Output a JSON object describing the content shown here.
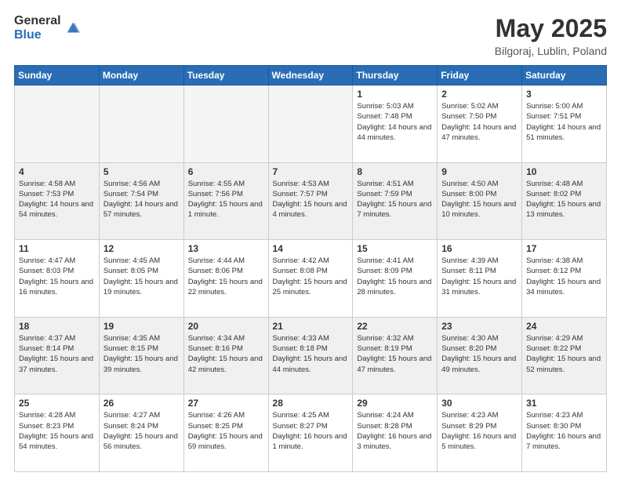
{
  "logo": {
    "general": "General",
    "blue": "Blue"
  },
  "header": {
    "title": "May 2025",
    "subtitle": "Bilgoraj, Lublin, Poland"
  },
  "days_of_week": [
    "Sunday",
    "Monday",
    "Tuesday",
    "Wednesday",
    "Thursday",
    "Friday",
    "Saturday"
  ],
  "weeks": [
    [
      {
        "day": "",
        "empty": true
      },
      {
        "day": "",
        "empty": true
      },
      {
        "day": "",
        "empty": true
      },
      {
        "day": "",
        "empty": true
      },
      {
        "day": "1",
        "sunrise": "5:03 AM",
        "sunset": "7:48 PM",
        "daylight": "14 hours and 44 minutes."
      },
      {
        "day": "2",
        "sunrise": "5:02 AM",
        "sunset": "7:50 PM",
        "daylight": "14 hours and 47 minutes."
      },
      {
        "day": "3",
        "sunrise": "5:00 AM",
        "sunset": "7:51 PM",
        "daylight": "14 hours and 51 minutes."
      }
    ],
    [
      {
        "day": "4",
        "sunrise": "4:58 AM",
        "sunset": "7:53 PM",
        "daylight": "14 hours and 54 minutes."
      },
      {
        "day": "5",
        "sunrise": "4:56 AM",
        "sunset": "7:54 PM",
        "daylight": "14 hours and 57 minutes."
      },
      {
        "day": "6",
        "sunrise": "4:55 AM",
        "sunset": "7:56 PM",
        "daylight": "15 hours and 1 minute."
      },
      {
        "day": "7",
        "sunrise": "4:53 AM",
        "sunset": "7:57 PM",
        "daylight": "15 hours and 4 minutes."
      },
      {
        "day": "8",
        "sunrise": "4:51 AM",
        "sunset": "7:59 PM",
        "daylight": "15 hours and 7 minutes."
      },
      {
        "day": "9",
        "sunrise": "4:50 AM",
        "sunset": "8:00 PM",
        "daylight": "15 hours and 10 minutes."
      },
      {
        "day": "10",
        "sunrise": "4:48 AM",
        "sunset": "8:02 PM",
        "daylight": "15 hours and 13 minutes."
      }
    ],
    [
      {
        "day": "11",
        "sunrise": "4:47 AM",
        "sunset": "8:03 PM",
        "daylight": "15 hours and 16 minutes."
      },
      {
        "day": "12",
        "sunrise": "4:45 AM",
        "sunset": "8:05 PM",
        "daylight": "15 hours and 19 minutes."
      },
      {
        "day": "13",
        "sunrise": "4:44 AM",
        "sunset": "8:06 PM",
        "daylight": "15 hours and 22 minutes."
      },
      {
        "day": "14",
        "sunrise": "4:42 AM",
        "sunset": "8:08 PM",
        "daylight": "15 hours and 25 minutes."
      },
      {
        "day": "15",
        "sunrise": "4:41 AM",
        "sunset": "8:09 PM",
        "daylight": "15 hours and 28 minutes."
      },
      {
        "day": "16",
        "sunrise": "4:39 AM",
        "sunset": "8:11 PM",
        "daylight": "15 hours and 31 minutes."
      },
      {
        "day": "17",
        "sunrise": "4:38 AM",
        "sunset": "8:12 PM",
        "daylight": "15 hours and 34 minutes."
      }
    ],
    [
      {
        "day": "18",
        "sunrise": "4:37 AM",
        "sunset": "8:14 PM",
        "daylight": "15 hours and 37 minutes."
      },
      {
        "day": "19",
        "sunrise": "4:35 AM",
        "sunset": "8:15 PM",
        "daylight": "15 hours and 39 minutes."
      },
      {
        "day": "20",
        "sunrise": "4:34 AM",
        "sunset": "8:16 PM",
        "daylight": "15 hours and 42 minutes."
      },
      {
        "day": "21",
        "sunrise": "4:33 AM",
        "sunset": "8:18 PM",
        "daylight": "15 hours and 44 minutes."
      },
      {
        "day": "22",
        "sunrise": "4:32 AM",
        "sunset": "8:19 PM",
        "daylight": "15 hours and 47 minutes."
      },
      {
        "day": "23",
        "sunrise": "4:30 AM",
        "sunset": "8:20 PM",
        "daylight": "15 hours and 49 minutes."
      },
      {
        "day": "24",
        "sunrise": "4:29 AM",
        "sunset": "8:22 PM",
        "daylight": "15 hours and 52 minutes."
      }
    ],
    [
      {
        "day": "25",
        "sunrise": "4:28 AM",
        "sunset": "8:23 PM",
        "daylight": "15 hours and 54 minutes."
      },
      {
        "day": "26",
        "sunrise": "4:27 AM",
        "sunset": "8:24 PM",
        "daylight": "15 hours and 56 minutes."
      },
      {
        "day": "27",
        "sunrise": "4:26 AM",
        "sunset": "8:25 PM",
        "daylight": "15 hours and 59 minutes."
      },
      {
        "day": "28",
        "sunrise": "4:25 AM",
        "sunset": "8:27 PM",
        "daylight": "16 hours and 1 minute."
      },
      {
        "day": "29",
        "sunrise": "4:24 AM",
        "sunset": "8:28 PM",
        "daylight": "16 hours and 3 minutes."
      },
      {
        "day": "30",
        "sunrise": "4:23 AM",
        "sunset": "8:29 PM",
        "daylight": "16 hours and 5 minutes."
      },
      {
        "day": "31",
        "sunrise": "4:23 AM",
        "sunset": "8:30 PM",
        "daylight": "16 hours and 7 minutes."
      }
    ]
  ]
}
